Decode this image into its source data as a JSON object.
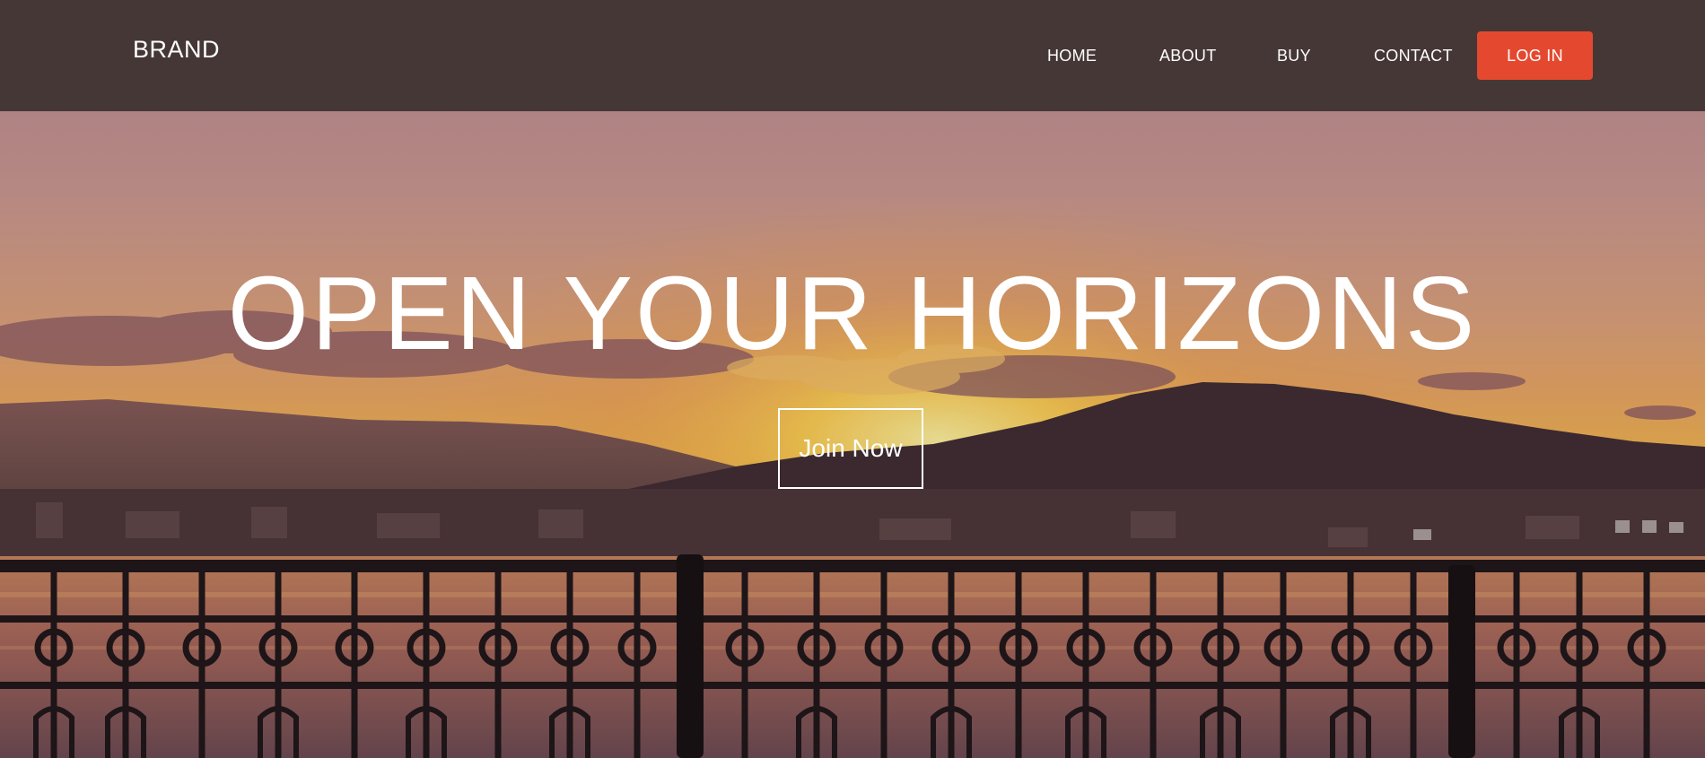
{
  "header": {
    "brand": "BRAND",
    "nav": [
      "HOME",
      "ABOUT",
      "BUY",
      "CONTACT"
    ],
    "login_label": "LOG IN"
  },
  "hero": {
    "title": "OPEN YOUR HORIZONS",
    "cta_label": "Join Now"
  },
  "colors": {
    "header_bg": "#3e3232",
    "accent": "#e4492f",
    "text": "#ffffff"
  }
}
